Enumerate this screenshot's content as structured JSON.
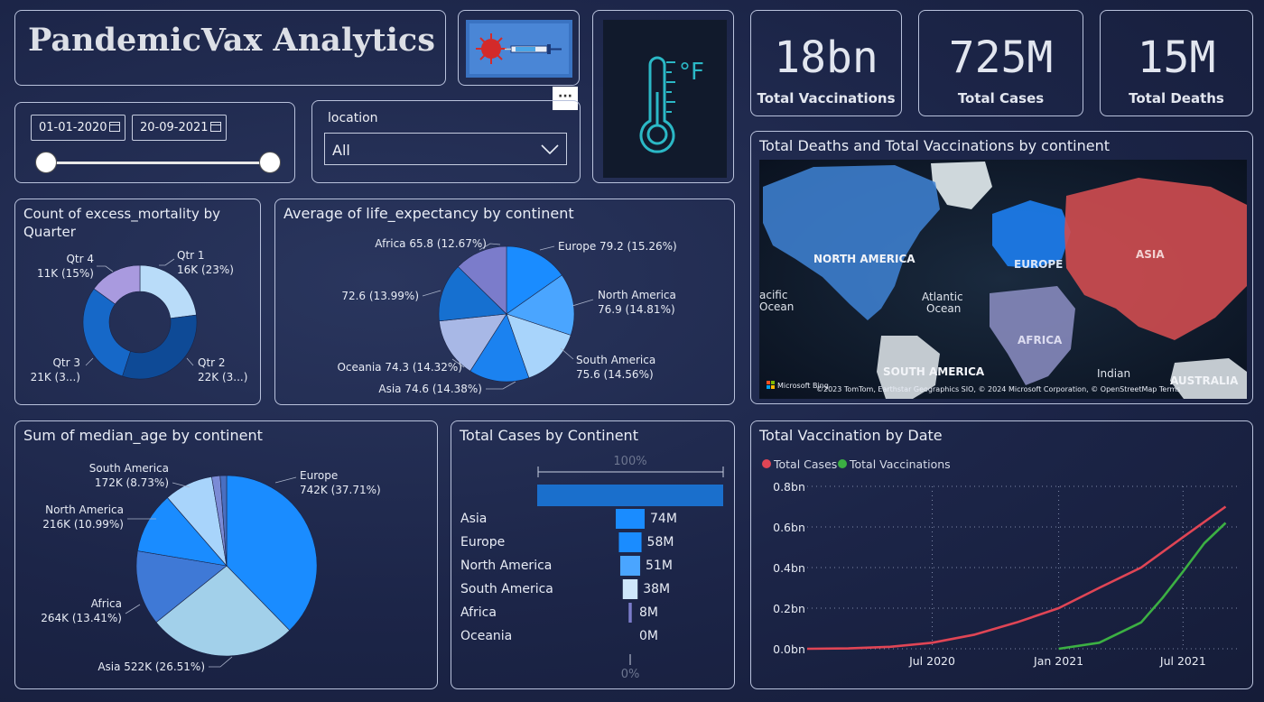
{
  "header": {
    "title": "PandemicVax Analytics"
  },
  "filters": {
    "date_start": "01-01-2020",
    "date_end": "20-09-2021",
    "location_label": "location",
    "location_value": "All",
    "more_button": "···"
  },
  "thermometer": {
    "unit": "°F"
  },
  "kpis": [
    {
      "value": "18bn",
      "label": "Total Vaccinations"
    },
    {
      "value": "725M",
      "label": "Total Cases"
    },
    {
      "value": "15M",
      "label": "Total Deaths"
    }
  ],
  "map": {
    "title": "Total Deaths and Total Vaccinations by continent",
    "labels": {
      "north_america": "NORTH AMERICA",
      "europe": "EUROPE",
      "asia": "ASIA",
      "africa": "AFRICA",
      "south_america": "SOUTH AMERICA",
      "australia": "AUSTRALIA",
      "atlantic": "Atlantic\nOcean",
      "pacific": "acific\nOcean",
      "indian": "Indian"
    },
    "attribution": "©2023 TomTom, Earthstar Geographics SIO, © 2024 Microsoft Corporation, © OpenStreetMap  Terms",
    "bing": "Microsoft Bing"
  },
  "chart_data": [
    {
      "type": "pie",
      "title": "Count of excess_mortality by Quarter",
      "donut": true,
      "categories": [
        "Qtr 1",
        "Qtr 2",
        "Qtr 3",
        "Qtr 4"
      ],
      "value_labels": [
        "16K (23%)",
        "22K (3...)",
        "21K (3...)",
        "11K (15%)"
      ],
      "values": [
        23,
        32,
        30,
        15
      ],
      "colors": [
        "#b9dcf9",
        "#0e4a96",
        "#1668c8",
        "#a99adf"
      ]
    },
    {
      "type": "pie",
      "title": "Average of life_expectancy by continent",
      "categories": [
        "Europe",
        "North America",
        "South America",
        "Asia",
        "Oceania",
        "",
        "Africa"
      ],
      "value_labels": [
        "79.2 (15.26%)",
        "76.9 (14.81%)",
        "75.6 (14.56%)",
        "74.6 (14.38%)",
        "74.3 (14.32%)",
        "72.6 (13.99%)",
        "65.8 (12.67%)"
      ],
      "values": [
        15.26,
        14.81,
        14.56,
        14.38,
        14.32,
        13.99,
        12.67
      ],
      "colors": [
        "#1a8cff",
        "#4aa5ff",
        "#a8d4fb",
        "#1b82f0",
        "#a8b8e6",
        "#1670d0",
        "#7b7ccb"
      ]
    },
    {
      "type": "pie",
      "title": "Sum of median_age by continent",
      "categories": [
        "Europe",
        "Asia",
        "Africa",
        "North America",
        "South America",
        "",
        ""
      ],
      "value_labels": [
        "742K (37.71%)",
        "522K (26.51%)",
        "264K (13.41%)",
        "216K (10.99%)",
        "172K (8.73%)",
        "",
        ""
      ],
      "values": [
        37.71,
        26.51,
        13.41,
        10.99,
        8.73,
        1.5,
        1.15
      ],
      "colors": [
        "#1a8cff",
        "#a2d0ea",
        "#3f79d6",
        "#1a8cff",
        "#a8d4fb",
        "#7b8bd6",
        "#4a6fc0"
      ]
    },
    {
      "type": "bar",
      "title": "Total Cases by Continent",
      "top_label": "100%",
      "bottom_label": "0%",
      "total_fraction": 1.0,
      "categories": [
        "Asia",
        "Europe",
        "North America",
        "South America",
        "Africa",
        "Oceania"
      ],
      "value_labels": [
        "74M",
        "58M",
        "51M",
        "38M",
        "8M",
        "0M"
      ],
      "values": [
        74,
        58,
        51,
        38,
        8,
        0
      ],
      "colors": [
        "#1a8cff",
        "#1a8cff",
        "#4aa5ff",
        "#cfe7fb",
        "#7b7ccb",
        "#7b7ccb"
      ]
    },
    {
      "type": "line",
      "title": "Total Vaccination by Date",
      "series": [
        {
          "name": "Total Cases",
          "color": "#e04555",
          "x": [
            "2020-01",
            "2020-03",
            "2020-05",
            "2020-07",
            "2020-09",
            "2020-11",
            "2021-01",
            "2021-03",
            "2021-05",
            "2021-07",
            "2021-09"
          ],
          "values": [
            0.0,
            0.002,
            0.01,
            0.03,
            0.07,
            0.13,
            0.2,
            0.3,
            0.4,
            0.55,
            0.7
          ]
        },
        {
          "name": "Total Vaccinations",
          "color": "#3cb043",
          "x": [
            "2021-01",
            "2021-03",
            "2021-05",
            "2021-06",
            "2021-07",
            "2021-08",
            "2021-09"
          ],
          "values": [
            0.0,
            0.03,
            0.13,
            0.25,
            0.38,
            0.52,
            0.62
          ]
        }
      ],
      "y_ticks": [
        "0.0bn",
        "0.2bn",
        "0.4bn",
        "0.6bn",
        "0.8bn"
      ],
      "ylim": [
        0,
        0.8
      ],
      "x_ticks": [
        "Jul 2020",
        "Jan 2021",
        "Jul 2021"
      ],
      "grid": true,
      "legend": "top-left"
    }
  ]
}
